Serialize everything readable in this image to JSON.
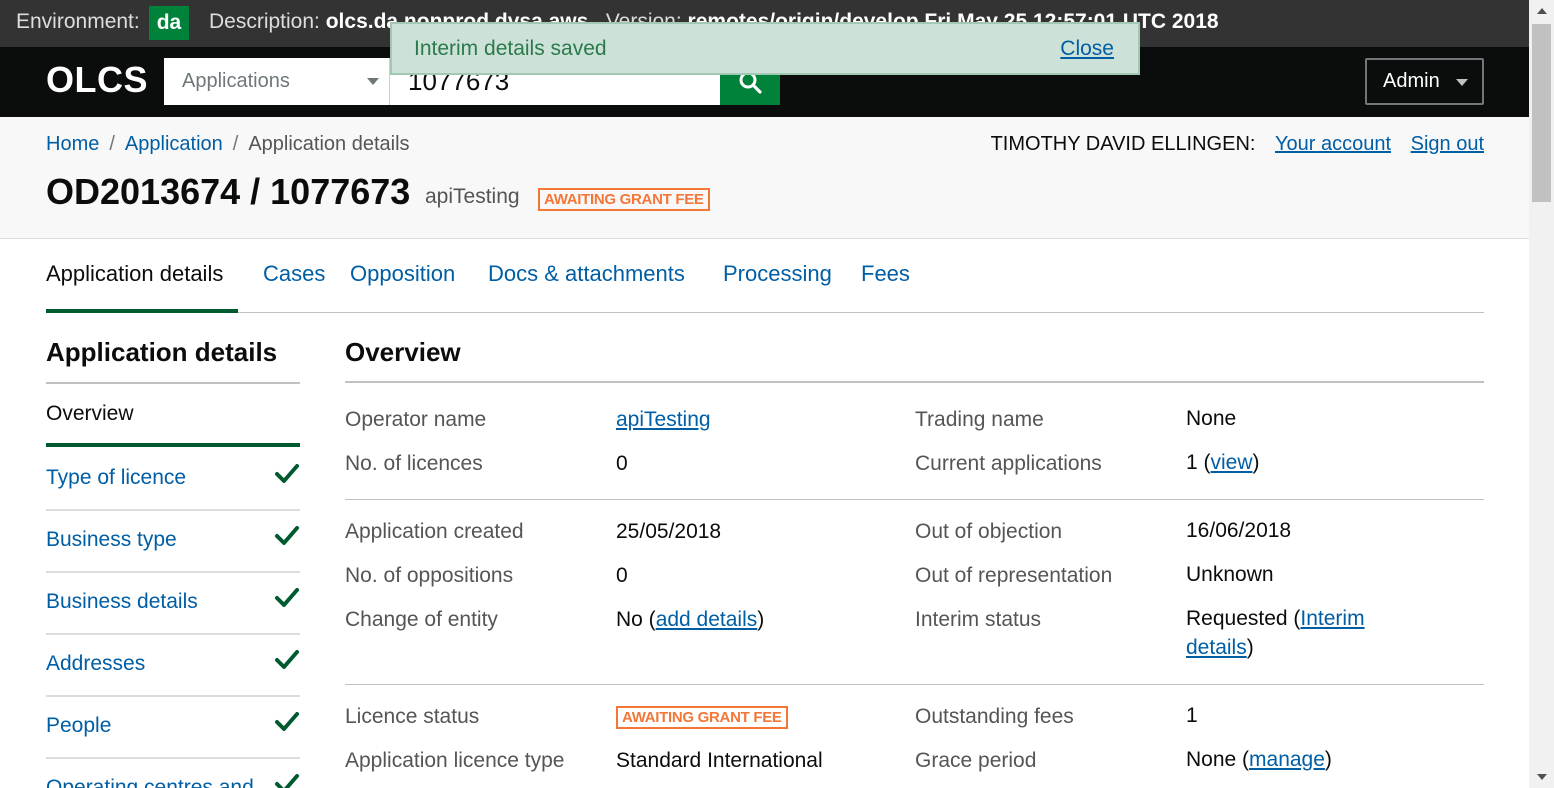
{
  "env": {
    "label": "Environment:",
    "env_value": "da",
    "description_label": "Description:",
    "description_value": "olcs.da.nonprod.dvsa.aws",
    "version_label": "Version:",
    "version_value": "remotes/origin/develop Fri May 25 12:57:01 UTC 2018"
  },
  "header": {
    "logo": "OLCS",
    "search_type": "Applications",
    "search_value": "1077673",
    "admin_label": "Admin"
  },
  "flash": {
    "message": "Interim details saved",
    "close_label": "Close"
  },
  "breadcrumb": {
    "items": [
      "Home",
      "Application",
      "Application details"
    ],
    "separator": "/"
  },
  "user": {
    "name": "TIMOTHY DAVID ELLINGEN:",
    "account_label": "Your account",
    "signout_label": "Sign out"
  },
  "page": {
    "title": "OD2013674 / 1077673",
    "operator": "apiTesting",
    "status": "AWAITING GRANT FEE"
  },
  "tabs": [
    "Application details",
    "Cases",
    "Opposition",
    "Docs & attachments",
    "Processing",
    "Fees"
  ],
  "sidenav": {
    "heading": "Application details",
    "current": "Overview",
    "items": [
      "Type of licence",
      "Business type",
      "Business details",
      "Addresses",
      "People",
      "Operating centres and"
    ]
  },
  "overview": {
    "heading": "Overview",
    "operator_name_label": "Operator name",
    "operator_name": "apiTesting",
    "trading_name_label": "Trading name",
    "trading_name": "None",
    "licences_label": "No. of licences",
    "licences": "0",
    "current_apps_label": "Current applications",
    "current_apps_count": "1 (",
    "current_apps_link": "view",
    "close_paren": ")",
    "created_label": "Application created",
    "created": "25/05/2018",
    "out_of_objection_label": "Out of objection",
    "out_of_objection": "16/06/2018",
    "oppositions_label": "No. of oppositions",
    "oppositions": "0",
    "out_of_rep_label": "Out of representation",
    "out_of_rep": "Unknown",
    "change_entity_label": "Change of entity",
    "change_entity_value": "No (",
    "change_entity_link": "add details",
    "interim_label": "Interim status",
    "interim_value": "Requested (",
    "interim_link_1": "Interim",
    "interim_link_2": "details",
    "licence_status_label": "Licence status",
    "licence_status": "AWAITING GRANT FEE",
    "outstanding_fees_label": "Outstanding fees",
    "outstanding_fees": "1",
    "licence_type_label": "Application licence type",
    "licence_type": "Standard International",
    "grace_label": "Grace period",
    "grace_value": "None (",
    "grace_link": "manage"
  },
  "colors": {
    "env_bar": "#333333",
    "env_badge": "#00823b",
    "header": "#0b0c0c",
    "search_button": "#00823b",
    "flash_bg": "#cce2d8",
    "flash_text": "#2b7a4b",
    "link": "#005ea5",
    "status_tag": "#f47738",
    "check": "#005a30"
  }
}
